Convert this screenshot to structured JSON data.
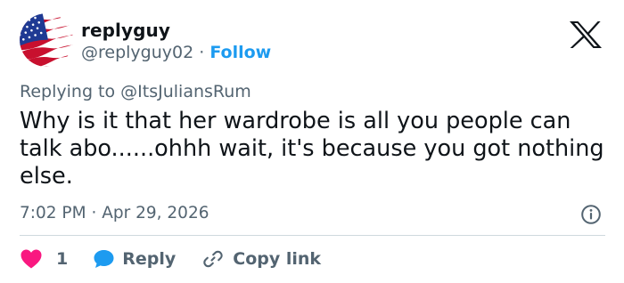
{
  "user": {
    "name": "replyguy",
    "handle": "@replyguy02",
    "separator": "·",
    "follow_label": "Follow",
    "avatar_icon": "us-flag-avatar"
  },
  "brand": {
    "logo": "x-logo-icon"
  },
  "tweet": {
    "replying_prefix": "Replying to",
    "replying_handle": "@ItsJuliansRum",
    "text": "Why is it that her wardrobe is all you people can talk abo......ohhh wait, it's because you got nothing else.",
    "time": "7:02 PM",
    "date_separator": "·",
    "date": "Apr 29, 2026"
  },
  "actions": {
    "like_count": "1",
    "reply_label": "Reply",
    "copy_link_label": "Copy link"
  },
  "colors": {
    "accent": "#1d9bf0",
    "like": "#f91880",
    "text": "#0f1419",
    "muted": "#536471",
    "divider": "#cfd9de"
  }
}
